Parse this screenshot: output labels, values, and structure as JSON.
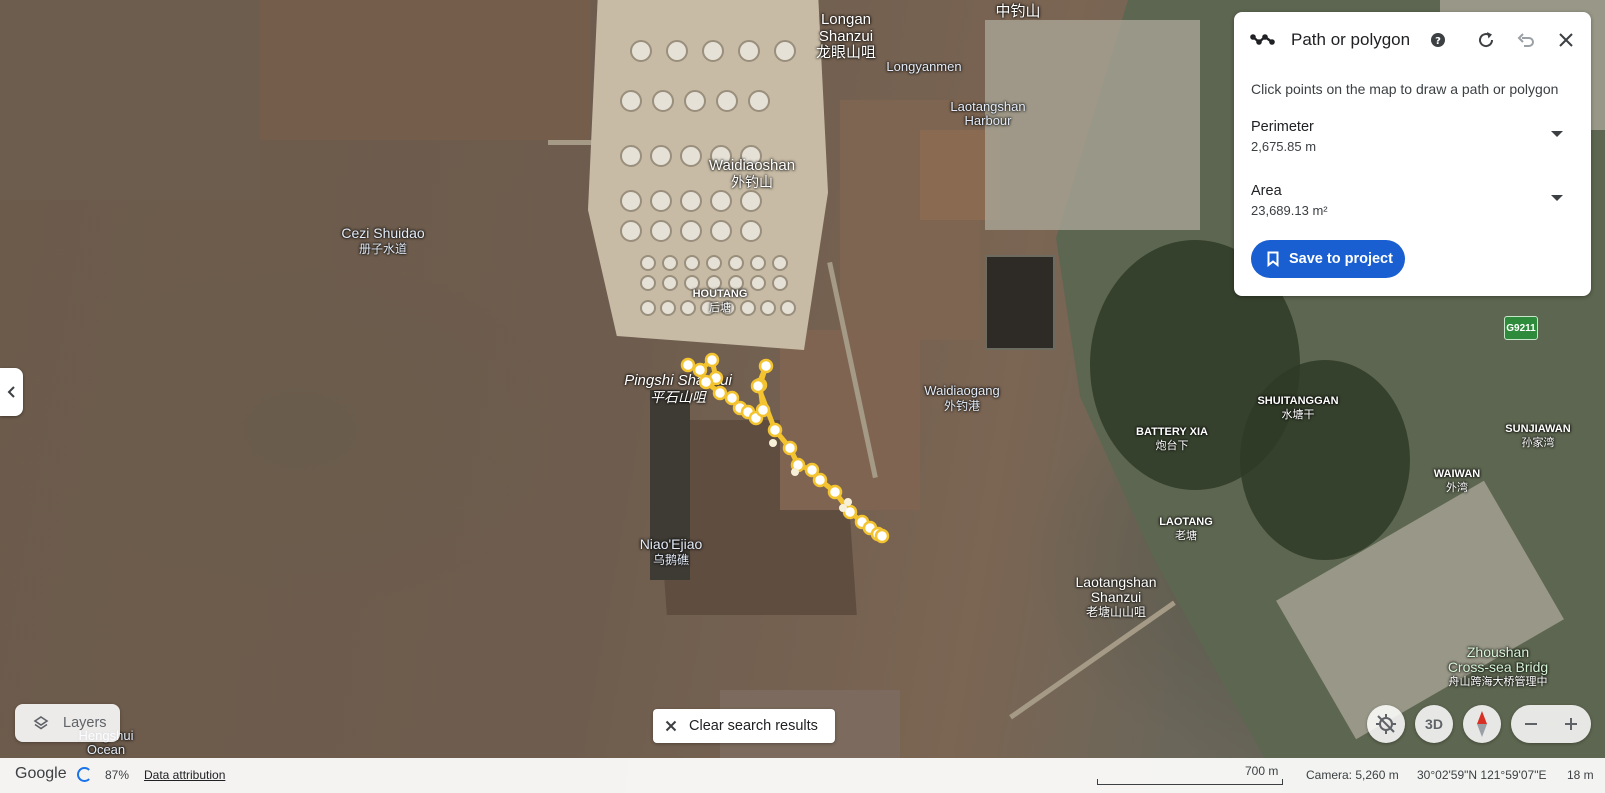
{
  "map_labels": {
    "longan": {
      "en": "Longan\nShanzui",
      "zh": "龙眼山咀"
    },
    "zhongdiao": {
      "zh": "中钓山"
    },
    "longyanmen": {
      "en": "Longyanmen"
    },
    "laotangshan_harbour": {
      "en": "Laotangshan\nHarbour"
    },
    "waidiaoshan": {
      "en": "Waidiaoshan",
      "zh": "外钓山"
    },
    "cezi": {
      "en": "Cezi Shuidao",
      "zh": "册子水道"
    },
    "houtang": {
      "en": "HOUTANG",
      "zh": "后塘"
    },
    "pingshi": {
      "en": "Pingshi Shanzui",
      "zh": "平石山咀"
    },
    "waidiaogang": {
      "en": "Waidiaogang",
      "zh": "外钓港"
    },
    "shuitanggan": {
      "en": "SHUITANGGAN",
      "zh": "水塘干"
    },
    "battery_xia": {
      "en": "BATTERY XIA",
      "zh": "炮台下"
    },
    "sunjiawan": {
      "en": "SUNJIAWAN",
      "zh": "孙家湾"
    },
    "waiwan": {
      "en": "WAIWAN",
      "zh": "外湾"
    },
    "laotang": {
      "en": "LAOTANG",
      "zh": "老塘"
    },
    "niaoejiao": {
      "en": "Niao'Ejiao",
      "zh": "乌鹅礁"
    },
    "laotangshan_shanzui": {
      "en": "Laotangshan\nShanzui",
      "zh": "老塘山山咀"
    },
    "zhoushan_bridge": {
      "en": "Zhoushan\nCross-sea Bridg",
      "zh": "舟山跨海大桥管理中"
    },
    "hengshui": {
      "en": "Hengshui\nOcean"
    },
    "road_shield": "G9211"
  },
  "panel": {
    "title": "Path or polygon",
    "hint": "Click points on the map to draw a path or polygon",
    "perimeter_label": "Perimeter",
    "perimeter_value": "2,675.85 m",
    "area_label": "Area",
    "area_value": "23,689.13 m²",
    "save_label": "Save to project"
  },
  "buttons": {
    "layers_label": "Layers",
    "clear_label": "Clear search results",
    "three_d_label": "3D"
  },
  "status": {
    "logo": "Google",
    "load_percent": "87%",
    "attribution": "Data attribution",
    "scale": "700 m",
    "camera": "Camera: 5,260 m",
    "coordinates": "30°02'59\"N 121°59'07\"E",
    "elevation": "18 m"
  },
  "colors": {
    "accent": "#1a5fd1",
    "path_line": "#f4c430",
    "path_point": "#ffffff"
  }
}
